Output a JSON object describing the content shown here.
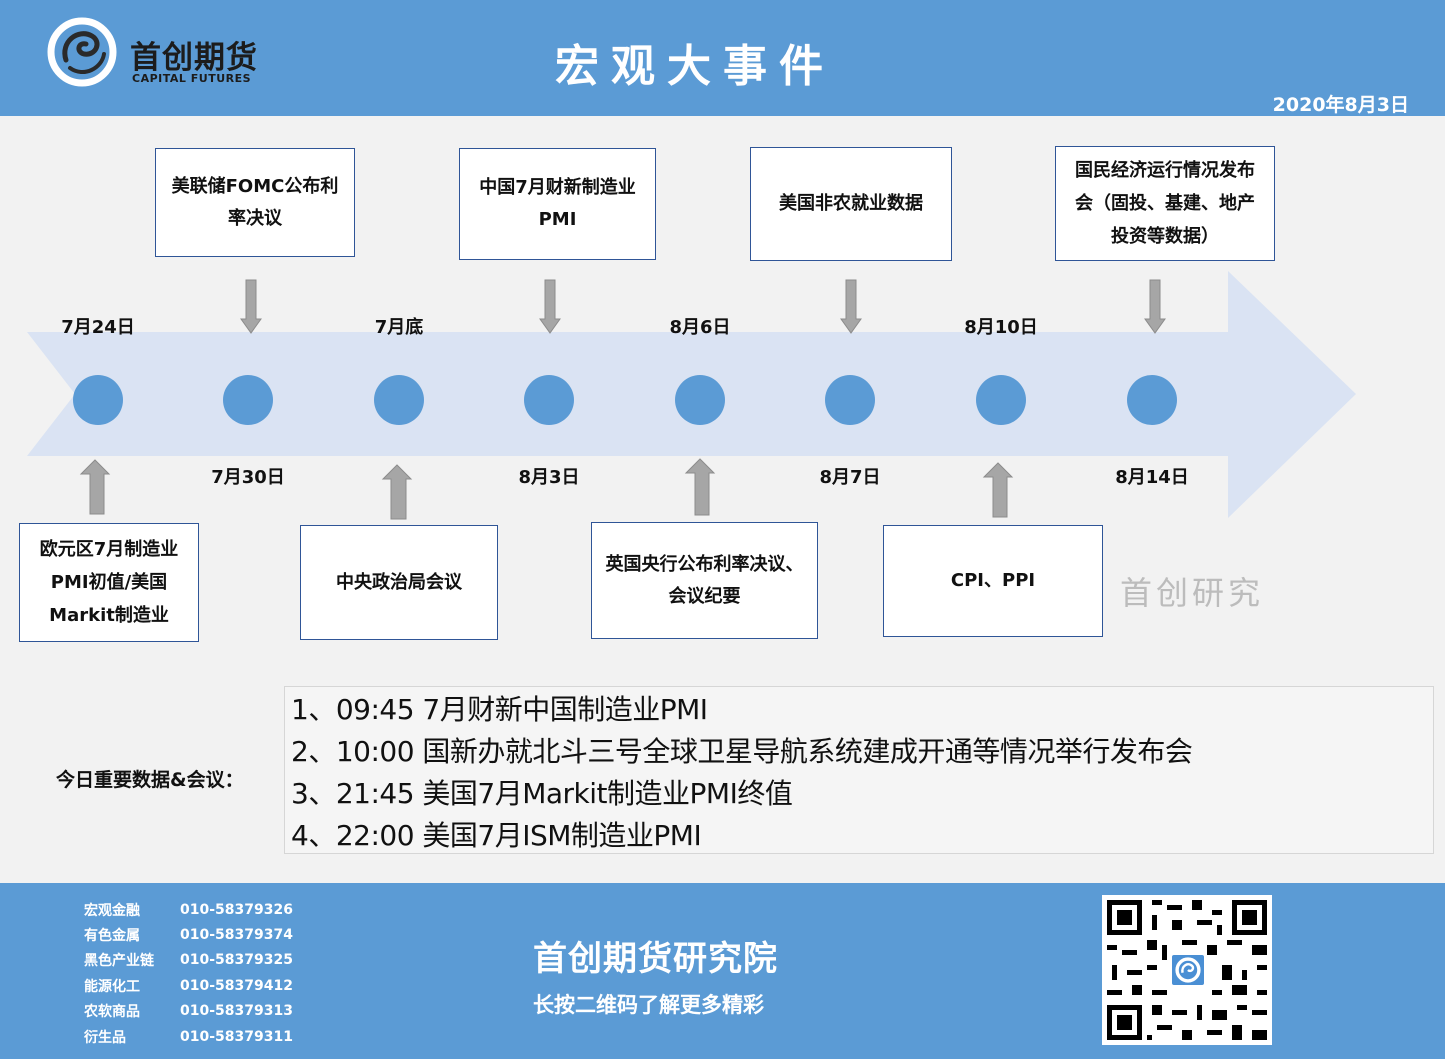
{
  "header": {
    "logo_cn": "首创期货",
    "logo_en": "CAPITAL FUTURES",
    "title": "宏观大事件",
    "date": "2020年8月3日"
  },
  "timeline": {
    "dates_top": [
      "7月24日",
      "7月底",
      "8月6日",
      "8月10日"
    ],
    "dates_bottom": [
      "7月30日",
      "8月3日",
      "8月7日",
      "8月14日"
    ],
    "events_top": [
      {
        "lines": [
          "美联储FOMC公布利",
          "率决议"
        ]
      },
      {
        "lines": [
          "中国7月财新制造业",
          "PMI"
        ]
      },
      {
        "lines": [
          "美国非农就业数据"
        ]
      },
      {
        "lines": [
          "国民经济运行情况发布",
          "会（固投、基建、地产",
          "投资等数据）"
        ]
      }
    ],
    "events_bottom": [
      {
        "lines": [
          "欧元区7月制造业",
          "PMI初值/美国",
          "Markit制造业"
        ]
      },
      {
        "lines": [
          "中央政治局会议"
        ]
      },
      {
        "lines": [
          "英国央行公布利率决议、",
          "会议纪要"
        ]
      },
      {
        "lines": [
          "CPI、PPI"
        ]
      }
    ],
    "colors": {
      "arrow": "#dae3f3",
      "dot": "#5b9bd5",
      "pointer": "#a6a6a6",
      "box_border": "#2f5597"
    }
  },
  "watermark": "首创研究",
  "today": {
    "label": "今日重要数据&会议：",
    "items": [
      "1、09:45 7月财新中国制造业PMI",
      "2、10:00 国新办就北斗三号全球卫星导航系统建成开通等情况举行发布会",
      "3、21:45 美国7月Markit制造业PMI终值",
      "4、22:00 美国7月ISM制造业PMI"
    ]
  },
  "footer": {
    "contacts": [
      {
        "dept": "宏观金融",
        "phone": "010-58379326"
      },
      {
        "dept": "有色金属",
        "phone": "010-58379374"
      },
      {
        "dept": "黑色产业链",
        "phone": "010-58379325"
      },
      {
        "dept": "能源化工",
        "phone": "010-58379412"
      },
      {
        "dept": "农软商品",
        "phone": "010-58379313"
      },
      {
        "dept": "衍生品",
        "phone": "010-58379311"
      }
    ],
    "title": "首创期货研究院",
    "subtitle": "长按二维码了解更多精彩"
  },
  "theme": {
    "primary": "#5b9bd5"
  }
}
